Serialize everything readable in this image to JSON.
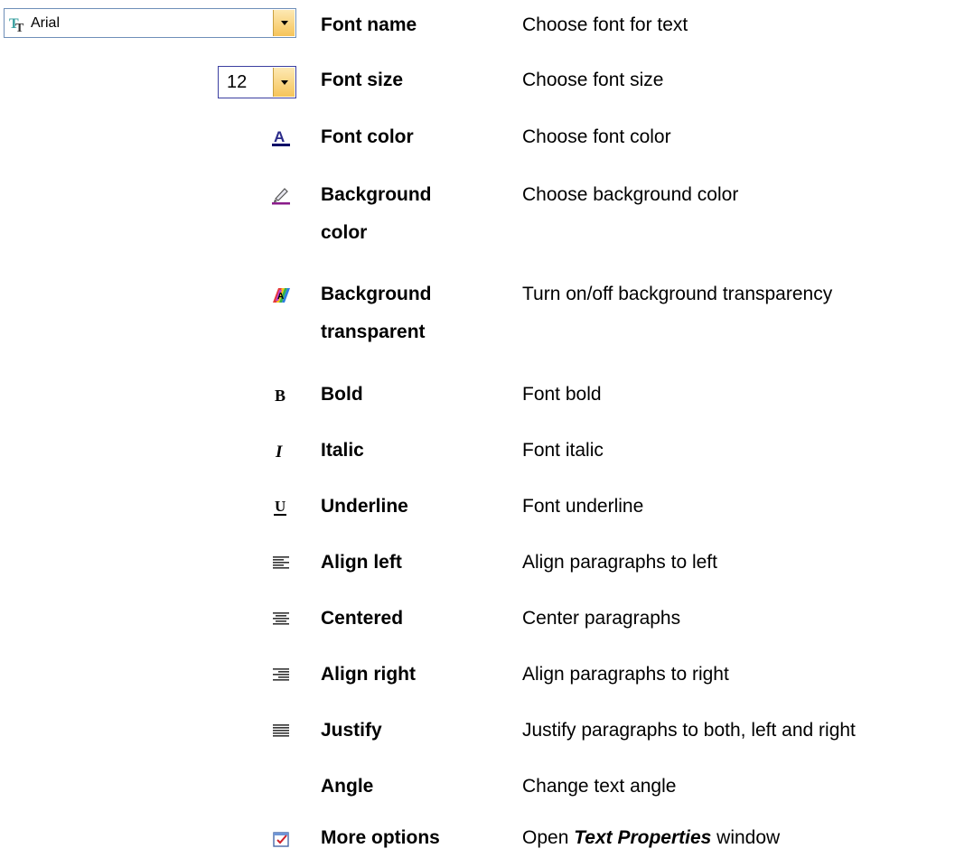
{
  "font_combo": {
    "value": "Arial"
  },
  "size_combo": {
    "value": "12"
  },
  "rows": [
    {
      "name": "Font name",
      "desc": "Choose font for text"
    },
    {
      "name": "Font size",
      "desc": "Choose font size"
    },
    {
      "name": "Font color",
      "desc": "Choose font color",
      "icon": "font-color-icon"
    },
    {
      "name_line1": "Background",
      "name_line2": "color",
      "desc": "Choose background color",
      "icon": "highlighter-icon"
    },
    {
      "name_line1": "Background",
      "name_line2": "transparent",
      "desc": "Turn on/off background transparency",
      "icon": "transparency-icon"
    },
    {
      "name": "Bold",
      "desc": "Font bold",
      "icon": "bold-icon"
    },
    {
      "name": "Italic",
      "desc": "Font italic",
      "icon": "italic-icon"
    },
    {
      "name": "Underline",
      "desc": "Font underline",
      "icon": "underline-icon"
    },
    {
      "name": "Align left",
      "desc": "Align paragraphs to left",
      "icon": "align-left-icon"
    },
    {
      "name": "Centered",
      "desc": "Center paragraphs",
      "icon": "align-center-icon"
    },
    {
      "name": "Align right",
      "desc": "Align paragraphs to right",
      "icon": "align-right-icon"
    },
    {
      "name": "Justify",
      "desc": "Justify paragraphs to both, left and right",
      "icon": "justify-icon"
    },
    {
      "name": "Angle",
      "desc": "Change text angle"
    },
    {
      "name": "More options",
      "desc_prefix": "Open ",
      "desc_emph": "Text Properties",
      "desc_suffix": " window",
      "icon": "properties-icon"
    }
  ]
}
